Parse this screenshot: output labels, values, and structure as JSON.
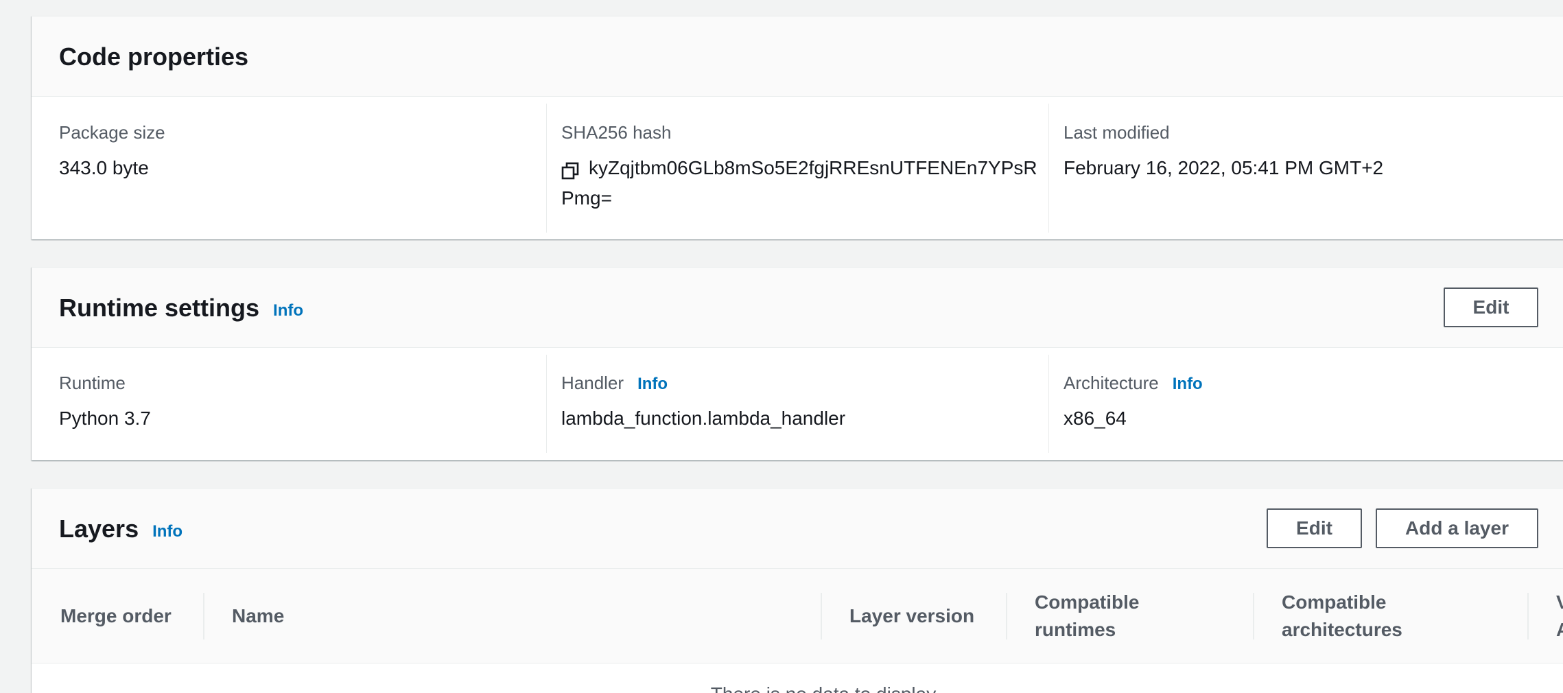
{
  "code_properties": {
    "title": "Code properties",
    "package_size_label": "Package size",
    "package_size_value": "343.0 byte",
    "sha_label": "SHA256 hash",
    "sha_value_line1": "kyZqjtbm06GLb8mSo5E2fgjRREsnUTFENEn7YPsR",
    "sha_value_line2": "Pmg=",
    "last_modified_label": "Last modified",
    "last_modified_value": "February 16, 2022, 05:41 PM GMT+2"
  },
  "runtime_settings": {
    "title": "Runtime settings",
    "info": "Info",
    "edit_label": "Edit",
    "runtime_label": "Runtime",
    "runtime_value": "Python 3.7",
    "handler_label": "Handler",
    "handler_info": "Info",
    "handler_value": "lambda_function.lambda_handler",
    "architecture_label": "Architecture",
    "architecture_info": "Info",
    "architecture_value": "x86_64"
  },
  "layers": {
    "title": "Layers",
    "info": "Info",
    "edit_label": "Edit",
    "add_label": "Add a layer",
    "columns": {
      "merge_order": "Merge order",
      "name": "Name",
      "layer_version": "Layer version",
      "compatible_runtimes_1": "Compatible",
      "compatible_runtimes_2": "runtimes",
      "compatible_architectures_1": "Compatible",
      "compatible_architectures_2": "architectures",
      "version_arn_1": "V",
      "version_arn_2": "A"
    },
    "empty_text": "There is no data to display"
  },
  "icons": {
    "copy": "copy-icon"
  }
}
